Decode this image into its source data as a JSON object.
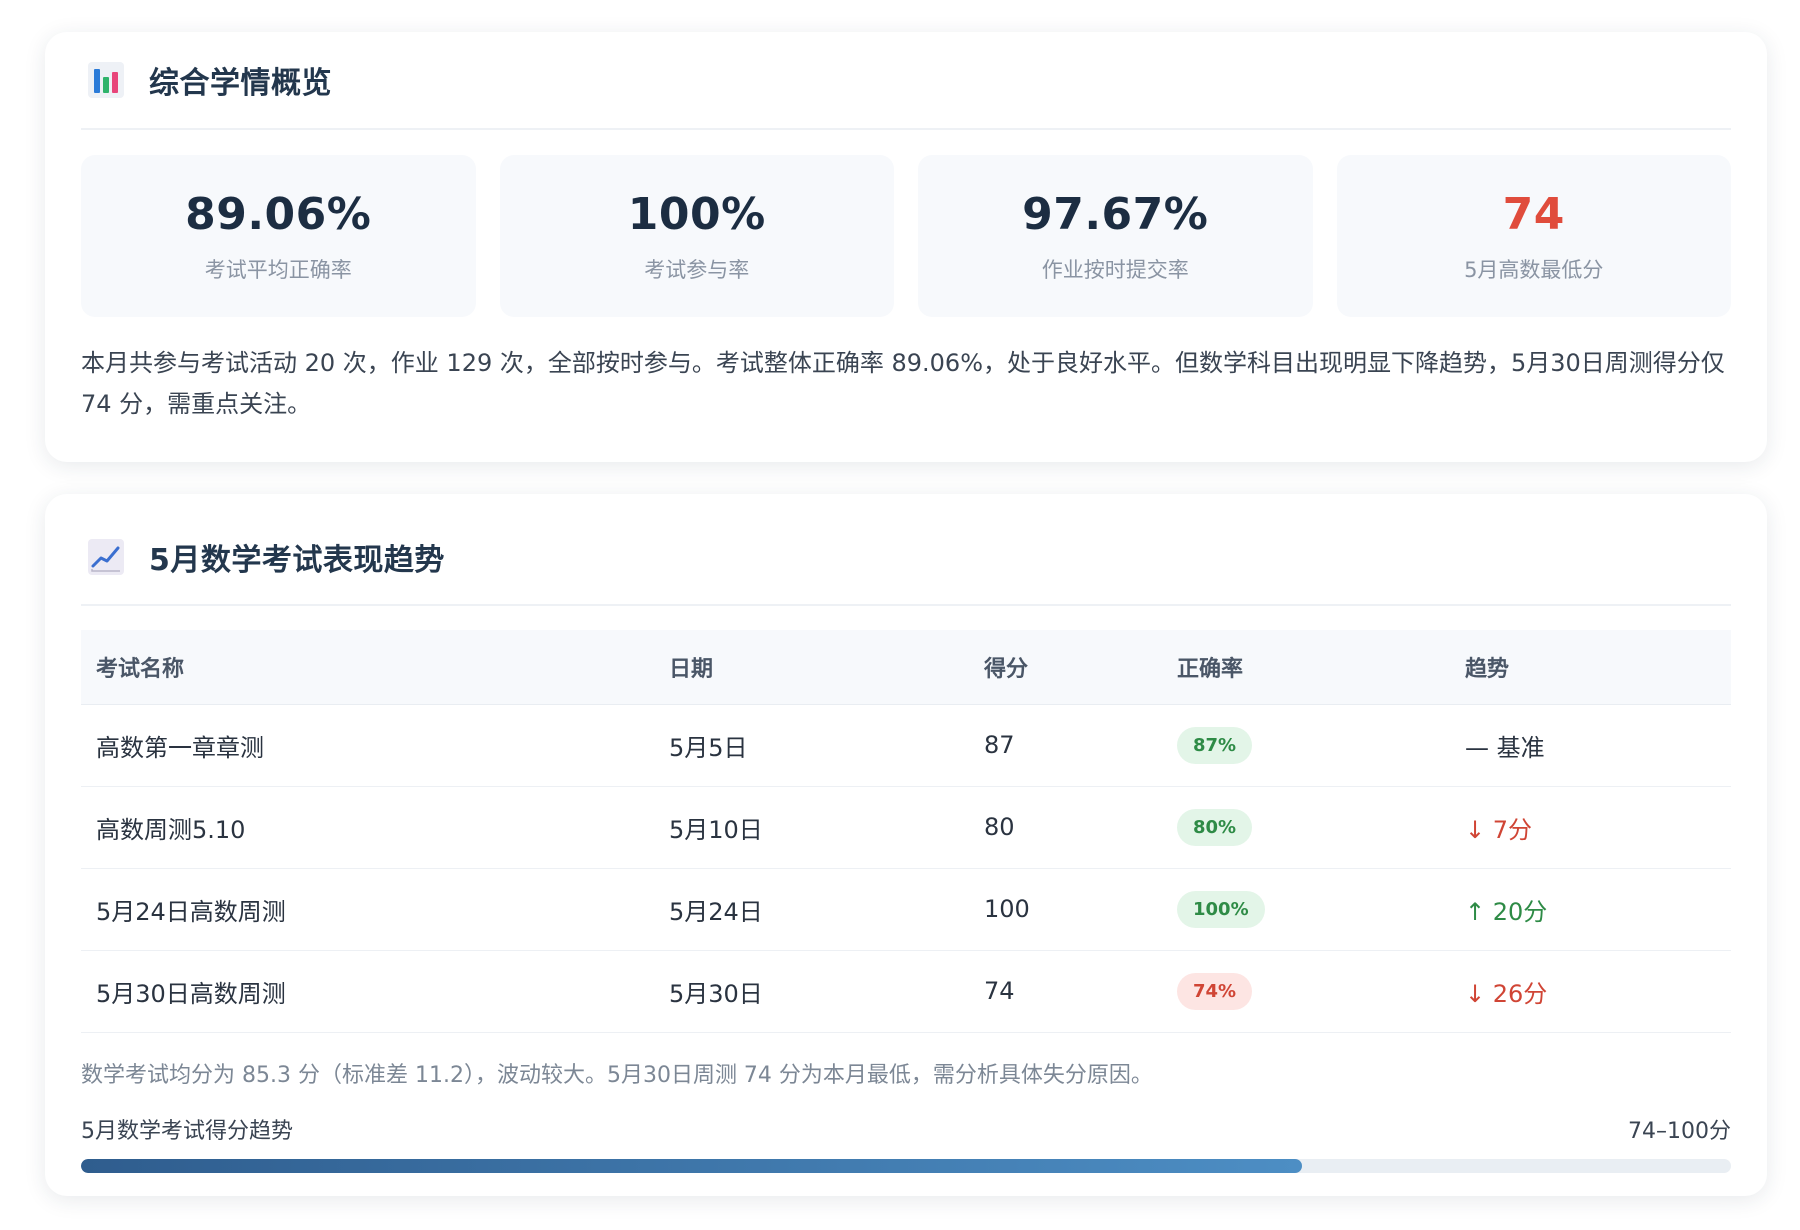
{
  "overview": {
    "title": "综合学情概览",
    "icon": "bar-chart-icon",
    "stats": [
      {
        "value": "89.06%",
        "label": "考试平均正确率"
      },
      {
        "value": "100%",
        "label": "考试参与率"
      },
      {
        "value": "97.67%",
        "label": "作业按时提交率"
      },
      {
        "value": "74",
        "label": "5月高数最低分"
      }
    ],
    "summary": "本月共参与考试活动 20 次，作业 129 次，全部按时参与。考试整体正确率 89.06%，处于良好水平。但数学科目出现明显下降趋势，5月30日周测得分仅 74 分，需重点关注。"
  },
  "trend": {
    "title": "5月数学考试表现趋势",
    "icon": "line-chart-icon",
    "columns": [
      "考试名称",
      "日期",
      "得分",
      "正确率",
      "趋势"
    ],
    "rows": [
      {
        "name": "高数第一章章测",
        "date": "5月5日",
        "score": "87",
        "rate": "87%",
        "trend": "— 基准"
      },
      {
        "name": "高数周测5.10",
        "date": "5月10日",
        "score": "80",
        "rate": "80%",
        "trend": "↓ 7分"
      },
      {
        "name": "5月24日高数周测",
        "date": "5月24日",
        "score": "100",
        "rate": "100%",
        "trend": "↑ 20分"
      },
      {
        "name": "5月30日高数周测",
        "date": "5月30日",
        "score": "74",
        "rate": "74%",
        "trend": "↓ 26分"
      }
    ],
    "note": "数学考试均分为 85.3 分（标准差 11.2），波动较大。5月30日周测 74 分为本月最低，需分析具体失分原因。",
    "bar_label": "5月数学考试得分趋势",
    "bar_range": "74–100分",
    "bar_fill_fraction": 0.74
  },
  "colors": {
    "danger": "#e04c3c",
    "good": "#2e8b46",
    "bar_start": "#2f5d8e",
    "bar_end": "#4d8ec4"
  }
}
